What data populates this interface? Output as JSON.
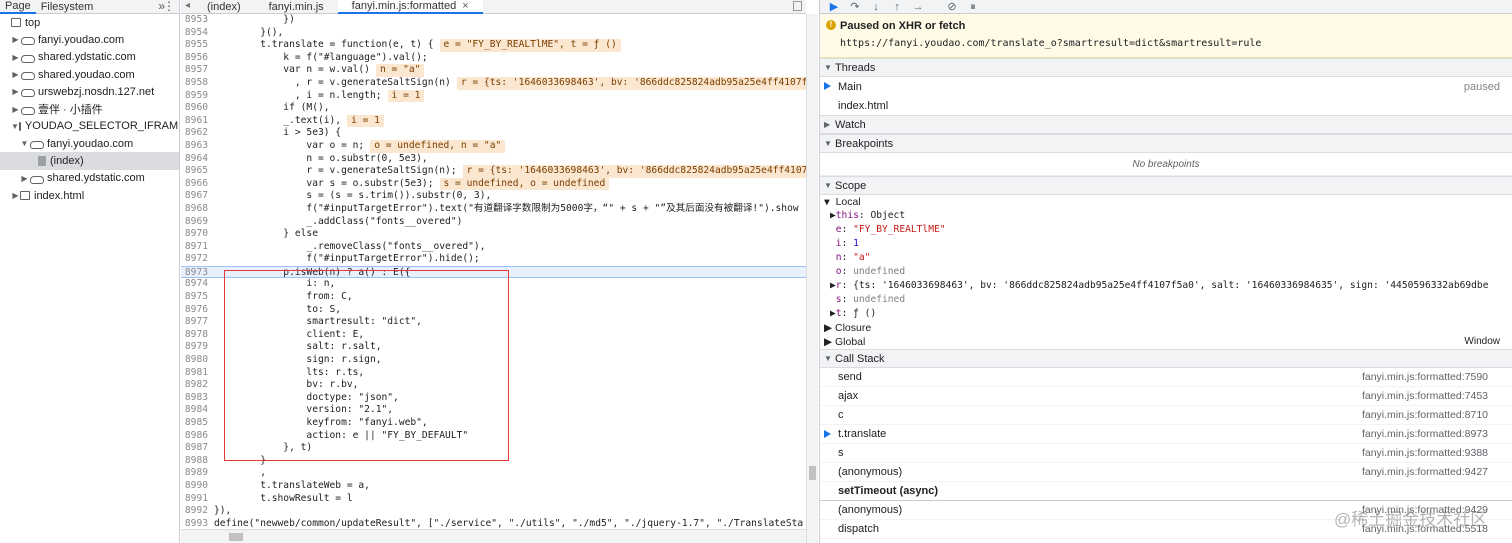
{
  "left": {
    "tabs": [
      "Page",
      "Filesystem"
    ],
    "more": "»",
    "tree": [
      {
        "label": "top",
        "level": 0,
        "arrow": "",
        "icon": "frame"
      },
      {
        "label": "fanyi.youdao.com",
        "level": 1,
        "arrow": "▶",
        "icon": "cloud"
      },
      {
        "label": "shared.ydstatic.com",
        "level": 1,
        "arrow": "▶",
        "icon": "cloud"
      },
      {
        "label": "shared.youdao.com",
        "level": 1,
        "arrow": "▶",
        "icon": "cloud"
      },
      {
        "label": "urswebzj.nosdn.127.net",
        "level": 1,
        "arrow": "▶",
        "icon": "cloud"
      },
      {
        "label": "壹伴 · 小插件",
        "level": 1,
        "arrow": "▶",
        "icon": "cloud"
      },
      {
        "label": "YOUDAO_SELECTOR_IFRAME (fa",
        "level": 1,
        "arrow": "▼",
        "icon": "frame"
      },
      {
        "label": "fanyi.youdao.com",
        "level": 2,
        "arrow": "▼",
        "icon": "cloud"
      },
      {
        "label": "(index)",
        "level": 3,
        "arrow": "",
        "icon": "file",
        "selected": true
      },
      {
        "label": "shared.ydstatic.com",
        "level": 2,
        "arrow": "▶",
        "icon": "cloud"
      },
      {
        "label": "index.html",
        "level": 1,
        "arrow": "▶",
        "icon": "frame"
      }
    ]
  },
  "editor": {
    "nav": "◂",
    "tabs": [
      {
        "label": "(index)",
        "active": false
      },
      {
        "label": "fanyi.min.js",
        "active": false
      },
      {
        "label": "fanyi.min.js:formatted",
        "active": true,
        "close": "×"
      }
    ],
    "lines": [
      {
        "n": "8953",
        "t": "            })"
      },
      {
        "n": "8954",
        "t": "        }(),"
      },
      {
        "n": "8955",
        "t": "        t.translate = function(e, t) {",
        "v": "e = \"FY_BY_REALTlME\", t = ƒ ()"
      },
      {
        "n": "8956",
        "t": "            k = f(\"#language\").val();"
      },
      {
        "n": "8957",
        "t": "            var n = w.val()",
        "v": "n = \"a\""
      },
      {
        "n": "8958",
        "t": "              , r = v.generateSaltSign(n)",
        "v": "r = {ts: '1646033698463', bv: '866ddc825824adb95a25e4ff4107f5a0', s"
      },
      {
        "n": "8959",
        "t": "              , i = n.length;",
        "v": "i = 1"
      },
      {
        "n": "8960",
        "t": "            if (M(),"
      },
      {
        "n": "8961",
        "t": "            _.text(i),",
        "v": "i = 1"
      },
      {
        "n": "8962",
        "t": "            i > 5e3) {"
      },
      {
        "n": "8963",
        "t": "                var o = n;",
        "v": "o = undefined, n = \"a\""
      },
      {
        "n": "8964",
        "t": "                n = o.substr(0, 5e3),"
      },
      {
        "n": "8965",
        "t": "                r = v.generateSaltSign(n);",
        "v": "r = {ts: '1646033698463', bv: '866ddc825824adb95a25e4ff4107f5a0',"
      },
      {
        "n": "8966",
        "t": "                var s = o.substr(5e3);",
        "v": "s = undefined, o = undefined"
      },
      {
        "n": "8967",
        "t": "                s = (s = s.trim()).substr(0, 3),"
      },
      {
        "n": "8968",
        "t": "                f(\"#inputTargetError\").text(\"有道翻译字数限制为5000字，“\" + s + \"”及其后面没有被翻译!\").show"
      },
      {
        "n": "8969",
        "t": "                _.addClass(\"fonts__overed\")"
      },
      {
        "n": "8970",
        "t": "            } else"
      },
      {
        "n": "8971",
        "t": "                _.removeClass(\"fonts__overed\"),"
      },
      {
        "n": "8972",
        "t": "                f(\"#inputTargetError\").hide();"
      },
      {
        "n": "8973",
        "t": "            p.isWeb(n) ? a() : E({",
        "exec": true
      },
      {
        "n": "8974",
        "t": "                i: n,"
      },
      {
        "n": "8975",
        "t": "                from: C,"
      },
      {
        "n": "8976",
        "t": "                to: S,"
      },
      {
        "n": "8977",
        "t": "                smartresult: \"dict\","
      },
      {
        "n": "8978",
        "t": "                client: E,"
      },
      {
        "n": "8979",
        "t": "                salt: r.salt,"
      },
      {
        "n": "8980",
        "t": "                sign: r.sign,"
      },
      {
        "n": "8981",
        "t": "                lts: r.ts,"
      },
      {
        "n": "8982",
        "t": "                bv: r.bv,"
      },
      {
        "n": "8983",
        "t": "                doctype: \"json\","
      },
      {
        "n": "8984",
        "t": "                version: \"2.1\","
      },
      {
        "n": "8985",
        "t": "                keyfrom: \"fanyi.web\","
      },
      {
        "n": "8986",
        "t": "                action: e || \"FY_BY_DEFAULT\""
      },
      {
        "n": "8987",
        "t": "            }, t)"
      },
      {
        "n": "8988",
        "t": "        }"
      },
      {
        "n": "8989",
        "t": "        ,"
      },
      {
        "n": "8990",
        "t": "        t.translateWeb = a,"
      },
      {
        "n": "8991",
        "t": "        t.showResult = l"
      },
      {
        "n": "8992",
        "t": "}),"
      },
      {
        "n": "8993",
        "t": "define(\"newweb/common/updateResult\", [\"./service\", \"./utils\", \"./md5\", \"./jquery-1.7\", \"./TranslateSta"
      },
      {
        "n": "8994",
        "t": ""
      }
    ]
  },
  "debugger": {
    "paused_title": "Paused on XHR or fetch",
    "paused_url": "https://fanyi.youdao.com/translate_o?smartresult=dict&smartresult=rule",
    "threads": {
      "title": "Threads",
      "items": [
        {
          "name": "Main",
          "state": "paused",
          "current": true
        },
        {
          "name": "index.html",
          "state": ""
        }
      ]
    },
    "watch_title": "Watch",
    "breakpoints": {
      "title": "Breakpoints",
      "empty": "No breakpoints"
    },
    "scope": {
      "title": "Scope",
      "local": "Local",
      "rows": [
        {
          "arrow": "▶",
          "key": "this",
          "sep": ": ",
          "val": "Object",
          "cls": ""
        },
        {
          "arrow": " ",
          "key": "e",
          "sep": ": ",
          "val": "\"FY_BY_REALTlME\"",
          "cls": "sstr"
        },
        {
          "arrow": " ",
          "key": "i",
          "sep": ": ",
          "val": "1",
          "cls": "snum"
        },
        {
          "arrow": " ",
          "key": "n",
          "sep": ": ",
          "val": "\"a\"",
          "cls": "sstr"
        },
        {
          "arrow": " ",
          "key": "o",
          "sep": ": ",
          "val": "undefined",
          "cls": "sgray"
        },
        {
          "arrow": "▶",
          "key": "r",
          "sep": ": ",
          "val": "{ts: '1646033698463', bv: '866ddc825824adb95a25e4ff4107f5a0', salt: '16460336984635', sign: '4450596332ab69dbe",
          "cls": ""
        },
        {
          "arrow": " ",
          "key": "s",
          "sep": ": ",
          "val": "undefined",
          "cls": "sgray"
        },
        {
          "arrow": "▶",
          "key": "t",
          "sep": ": ",
          "val": "ƒ ()",
          "cls": ""
        }
      ],
      "closure": "Closure",
      "global": "Global",
      "global_value": "Window"
    },
    "callstack": {
      "title": "Call Stack",
      "frames": [
        {
          "name": "send",
          "loc": "fanyi.min.js:formatted:7590"
        },
        {
          "name": "ajax",
          "loc": "fanyi.min.js:formatted:7453"
        },
        {
          "name": "c",
          "loc": "fanyi.min.js:formatted:8710"
        },
        {
          "name": "t.translate",
          "loc": "fanyi.min.js:formatted:8973",
          "current": true
        },
        {
          "name": "s",
          "loc": "fanyi.min.js:formatted:9388"
        },
        {
          "name": "(anonymous)",
          "loc": "fanyi.min.js:formatted:9427"
        },
        {
          "name": "setTimeout (async)",
          "loc": "",
          "async": true
        },
        {
          "name": "(anonymous)",
          "loc": "fanyi.min.js:formatted:9429"
        },
        {
          "name": "dispatch",
          "loc": "fanyi.min.js:formatted:5518"
        }
      ]
    }
  },
  "watermark": "@稀土掘金技术社区"
}
